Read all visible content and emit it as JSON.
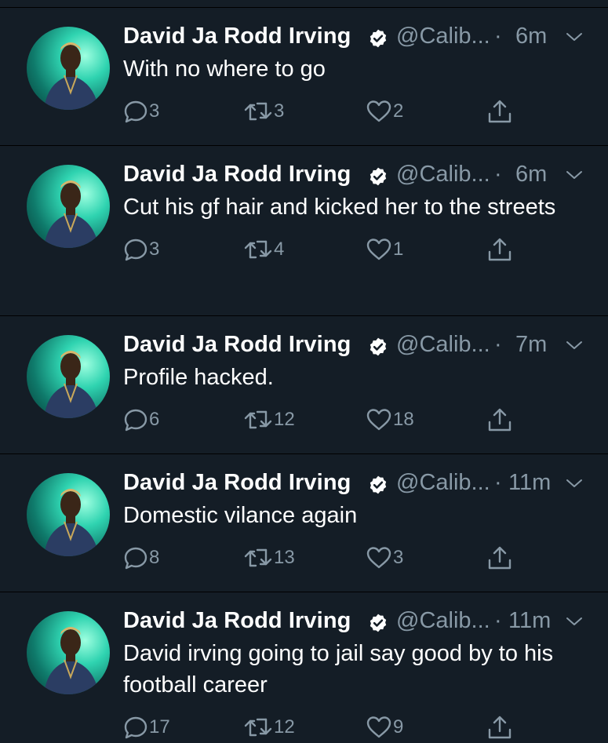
{
  "colors": {
    "background": "#141d26",
    "text": "#ffffff",
    "secondary": "#8899a6",
    "divider": "#000000"
  },
  "tweets": [
    {
      "name": "David Ja Rodd Irving",
      "handle": "@Calib...",
      "separator": "·",
      "time": "6m",
      "text": "With no where to go",
      "replies": "3",
      "retweets": "3",
      "likes": "2"
    },
    {
      "name": "David Ja Rodd Irving",
      "handle": "@Calib...",
      "separator": "·",
      "time": "6m",
      "text": "Cut his gf hair and kicked her to the streets",
      "replies": "3",
      "retweets": "4",
      "likes": "1"
    },
    {
      "name": "David Ja Rodd Irving",
      "handle": "@Calib...",
      "separator": "·",
      "time": "7m",
      "text": "Profile hacked.",
      "replies": "6",
      "retweets": "12",
      "likes": "18"
    },
    {
      "name": "David Ja Rodd Irving",
      "handle": "@Calib...",
      "separator": "·",
      "time": "11m",
      "text": "Domestic vilance again",
      "replies": "8",
      "retweets": "13",
      "likes": "3"
    },
    {
      "name": "David Ja Rodd Irving",
      "handle": "@Calib...",
      "separator": "·",
      "time": "11m",
      "text": "David irving going to jail say good by to his football career",
      "replies": "17",
      "retweets": "12",
      "likes": "9"
    }
  ],
  "icons": {
    "verified": "verified-badge-icon",
    "chevron": "chevron-down-icon",
    "reply": "reply-icon",
    "retweet": "retweet-icon",
    "like": "heart-icon",
    "share": "share-icon"
  }
}
